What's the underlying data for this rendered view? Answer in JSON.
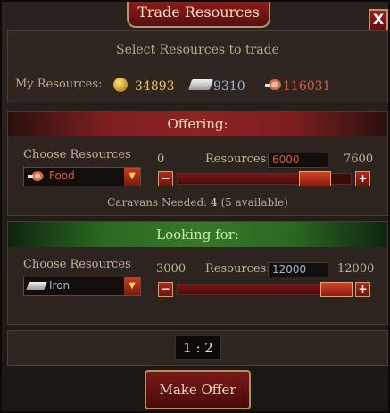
{
  "window": {
    "title": "Trade Resources",
    "close_label": "X"
  },
  "top": {
    "subtitle": "Select Resources to trade",
    "my_resources_label": "My Resources:",
    "gold": "34893",
    "iron": "9310",
    "food": "116031",
    "colors": {
      "gold": "#f0c24a",
      "iron": "#9fb8d4",
      "food": "#e05a3a"
    }
  },
  "offering": {
    "header": "Offering:",
    "choose_label": "Choose Resources",
    "selected": "Food",
    "selected_icon": "meat-icon",
    "min": "0",
    "max": "7600",
    "resources_label": "Resources:",
    "value": "6000",
    "slider_fraction": 0.79,
    "caravans_label": "Caravans Needed:",
    "caravans_needed": "4",
    "caravans_available": "(5 available)"
  },
  "looking": {
    "header": "Looking for:",
    "choose_label": "Choose Resources",
    "selected": "Iron",
    "selected_icon": "iron-ingot-icon",
    "min": "3000",
    "max": "12000",
    "resources_label": "Resources:",
    "value": "12000",
    "slider_fraction": 1.0
  },
  "ratio": "1 : 2",
  "make_offer_label": "Make Offer"
}
